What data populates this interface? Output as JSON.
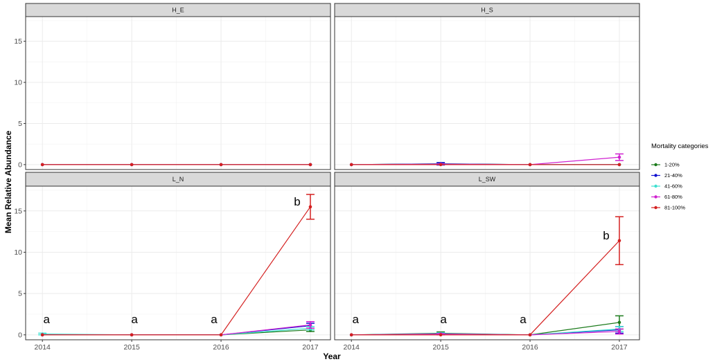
{
  "chart_data": {
    "type": "line",
    "facets_layout": "2x2 grid, shared axes",
    "x": [
      "2014",
      "2015",
      "2016",
      "2017"
    ],
    "xlabel": "Year",
    "ylabel": "Mean Relative Abundance",
    "ylim": [
      -0.6,
      18
    ],
    "yticks": [
      0,
      5,
      10,
      15
    ],
    "grid": true,
    "legend": {
      "title": "Mortality categories",
      "position": "right"
    },
    "categories": [
      {
        "name": "1-20%",
        "color": "#1a7a1a"
      },
      {
        "name": "21-40%",
        "color": "#1010d0"
      },
      {
        "name": "41-60%",
        "color": "#3de0d0"
      },
      {
        "name": "61-80%",
        "color": "#d020d0"
      },
      {
        "name": "81-100%",
        "color": "#d42020"
      }
    ],
    "panels": [
      {
        "strip": "H_E",
        "series": [
          {
            "name": "1-20%",
            "values": [
              0,
              0,
              0,
              0
            ],
            "se": [
              0,
              0,
              0,
              0
            ]
          },
          {
            "name": "21-40%",
            "values": [
              0,
              0,
              0,
              0
            ],
            "se": [
              0,
              0,
              0,
              0
            ]
          },
          {
            "name": "41-60%",
            "values": [
              0,
              0,
              0,
              0
            ],
            "se": [
              0,
              0,
              0,
              0
            ]
          },
          {
            "name": "61-80%",
            "values": [
              0,
              0,
              0,
              0
            ],
            "se": [
              0,
              0,
              0,
              0
            ]
          },
          {
            "name": "81-100%",
            "values": [
              0,
              0,
              0,
              0
            ],
            "se": [
              0,
              0,
              0,
              0
            ]
          }
        ],
        "letters": []
      },
      {
        "strip": "H_S",
        "series": [
          {
            "name": "1-20%",
            "values": [
              0,
              0.1,
              0,
              0
            ],
            "se": [
              0,
              0.05,
              0,
              0
            ]
          },
          {
            "name": "21-40%",
            "values": [
              0,
              0.1,
              0,
              0
            ],
            "se": [
              0,
              0.15,
              0,
              0
            ]
          },
          {
            "name": "41-60%",
            "values": [
              0,
              0.05,
              0,
              0
            ],
            "se": [
              0,
              0.05,
              0,
              0
            ]
          },
          {
            "name": "61-80%",
            "values": [
              0,
              0.05,
              0,
              0.9
            ],
            "se": [
              0,
              0.05,
              0,
              0.4
            ]
          },
          {
            "name": "81-100%",
            "values": [
              0,
              0,
              0,
              0
            ],
            "se": [
              0,
              0,
              0,
              0
            ]
          }
        ],
        "letters": []
      },
      {
        "strip": "L_N",
        "series": [
          {
            "name": "1-20%",
            "values": [
              0,
              0,
              0,
              0.6
            ],
            "se": [
              0,
              0,
              0,
              0.2
            ]
          },
          {
            "name": "21-40%",
            "values": [
              0,
              0,
              0,
              1.1
            ],
            "se": [
              0,
              0,
              0,
              0.3
            ]
          },
          {
            "name": "41-60%",
            "values": [
              0.1,
              0,
              0,
              0.8
            ],
            "se": [
              0.1,
              0,
              0,
              0.2
            ]
          },
          {
            "name": "61-80%",
            "values": [
              0,
              0,
              0,
              1.2
            ],
            "se": [
              0,
              0,
              0,
              0.4
            ]
          },
          {
            "name": "81-100%",
            "values": [
              0,
              0,
              0,
              15.5
            ],
            "se": [
              0,
              0,
              0,
              1.5
            ]
          }
        ],
        "letters": [
          {
            "x": "2014",
            "text": "a"
          },
          {
            "x": "2015",
            "text": "a"
          },
          {
            "x": "2016",
            "text": "a"
          },
          {
            "x": "2017",
            "text": "b"
          }
        ]
      },
      {
        "strip": "L_SW",
        "series": [
          {
            "name": "1-20%",
            "values": [
              0,
              0.2,
              0,
              1.5
            ],
            "se": [
              0,
              0.15,
              0,
              0.8
            ]
          },
          {
            "name": "21-40%",
            "values": [
              0,
              0.1,
              0,
              0.6
            ],
            "se": [
              0,
              0.1,
              0,
              0.4
            ]
          },
          {
            "name": "41-60%",
            "values": [
              0,
              0.15,
              0,
              0.7
            ],
            "se": [
              0,
              0.1,
              0,
              0.3
            ]
          },
          {
            "name": "61-80%",
            "values": [
              0,
              0.1,
              0,
              0.4
            ],
            "se": [
              0,
              0.05,
              0,
              0.3
            ]
          },
          {
            "name": "81-100%",
            "values": [
              0,
              0,
              0,
              11.4
            ],
            "se": [
              0,
              0,
              0,
              2.9
            ]
          }
        ],
        "letters": [
          {
            "x": "2014",
            "text": "a"
          },
          {
            "x": "2015",
            "text": "a"
          },
          {
            "x": "2016",
            "text": "a"
          },
          {
            "x": "2017",
            "text": "b"
          }
        ]
      }
    ]
  }
}
